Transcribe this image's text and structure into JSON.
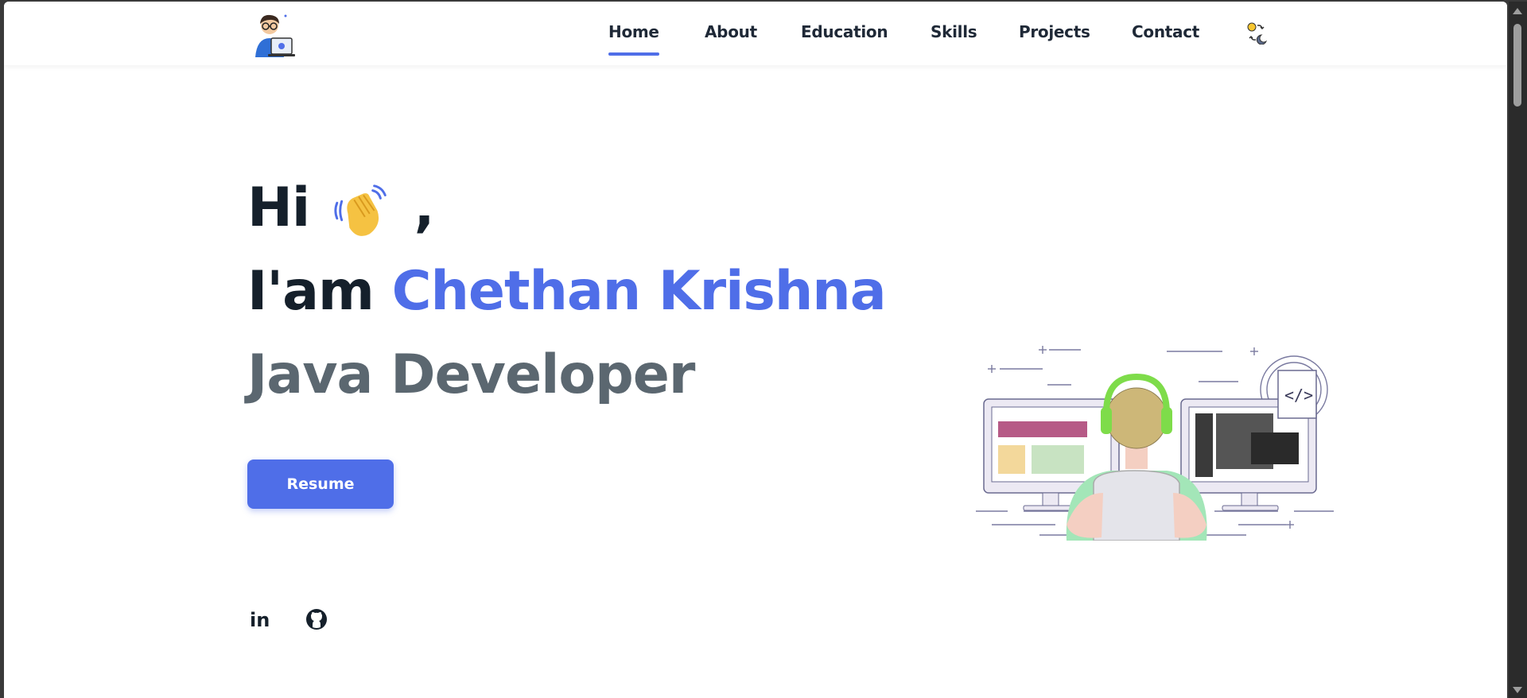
{
  "nav": {
    "items": [
      {
        "label": "Home",
        "active": true
      },
      {
        "label": "About",
        "active": false
      },
      {
        "label": "Education",
        "active": false
      },
      {
        "label": "Skills",
        "active": false
      },
      {
        "label": "Projects",
        "active": false
      },
      {
        "label": "Contact",
        "active": false
      }
    ],
    "theme_toggle_icon": "sun-moon-toggle-icon",
    "logo_icon": "developer-avatar-icon"
  },
  "hero": {
    "greeting": "Hi",
    "greeting_emoji": "waving-hand-icon",
    "greeting_comma": ",",
    "intro_prefix": "I'am",
    "name": "Chethan Krishna",
    "role": "Java Developer",
    "resume_label": "Resume",
    "illustration": "developer-at-desk-illustration"
  },
  "social": [
    {
      "icon": "linkedin-icon",
      "label": "in"
    },
    {
      "icon": "github-icon"
    }
  ],
  "colors": {
    "accent": "#4f6ee8",
    "heading": "#15202b",
    "role": "#5b6770",
    "background": "#ffffff"
  }
}
